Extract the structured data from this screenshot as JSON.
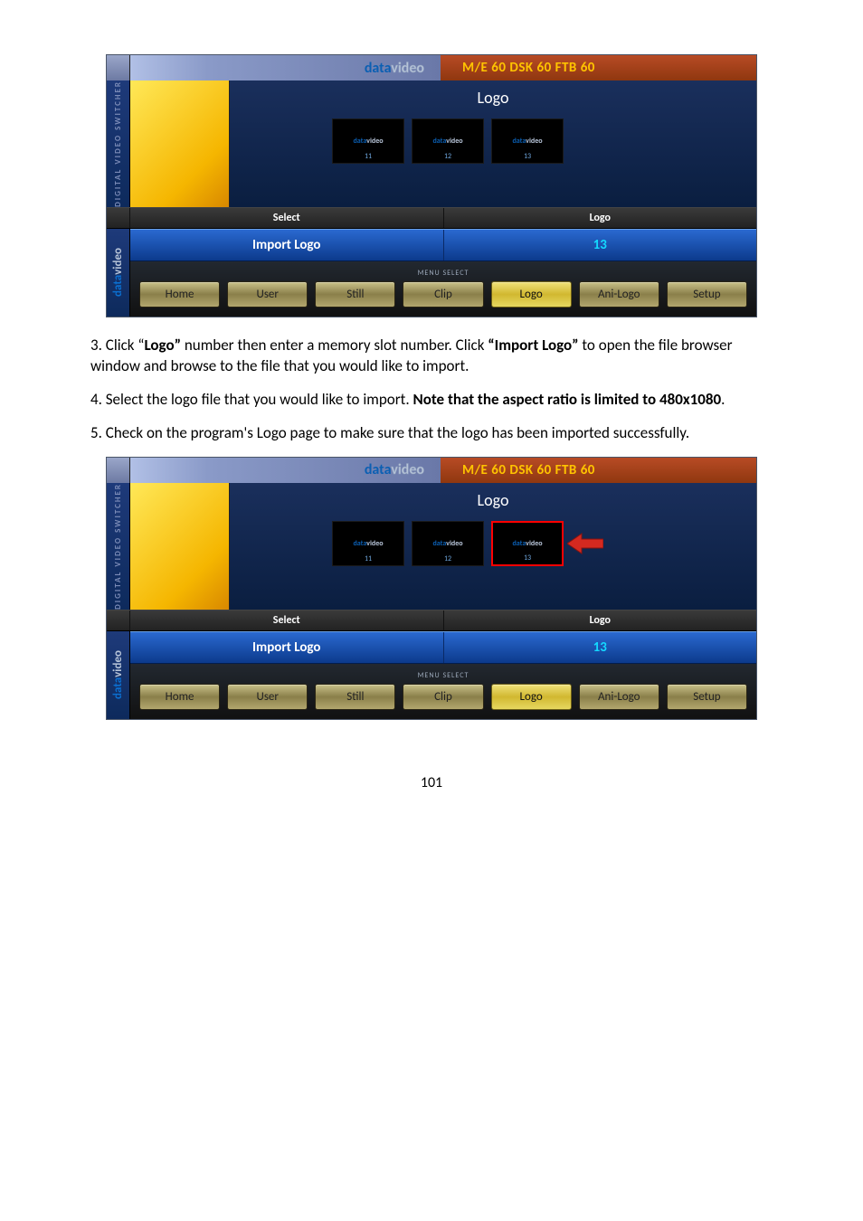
{
  "brand": {
    "part1": "data",
    "part2": "video"
  },
  "top_status": "M/E 60  DSK 60  FTB 60",
  "sidebar_vertical": "DIGITAL VIDEO SWITCHER",
  "preview": {
    "title": "Logo",
    "thumbs": [
      {
        "logo1": "data",
        "logo2": "video",
        "num": "11"
      },
      {
        "logo1": "data",
        "logo2": "video",
        "num": "12"
      },
      {
        "logo1": "data",
        "logo2": "video",
        "num": "13"
      }
    ]
  },
  "labels": {
    "select": "Select",
    "logo": "Logo"
  },
  "bluebar": {
    "import_logo": "Import Logo",
    "slot": "13"
  },
  "menu_select_label": "MENU SELECT",
  "menu": {
    "home": "Home",
    "user": "User",
    "still": "Still",
    "clip": "Clip",
    "logo": "Logo",
    "anilogo": "Ani-Logo",
    "setup": "Setup"
  },
  "instructions": {
    "step3_a": "3. Click “",
    "step3_b": "Logo”",
    "step3_c": " number then enter a memory slot number. Click ",
    "step3_d": "“Import Logo”",
    "step3_e": " to open the file browser window and browse to the file that you would like to import.",
    "step4_a": "4. Select the logo file that you would like to import. ",
    "step4_b": "Note that the aspect ratio is limited to 480x1080",
    "step4_c": ".",
    "step5": "5. Check on the program's Logo page to make sure that the logo has been imported successfully."
  },
  "page_number": "101"
}
